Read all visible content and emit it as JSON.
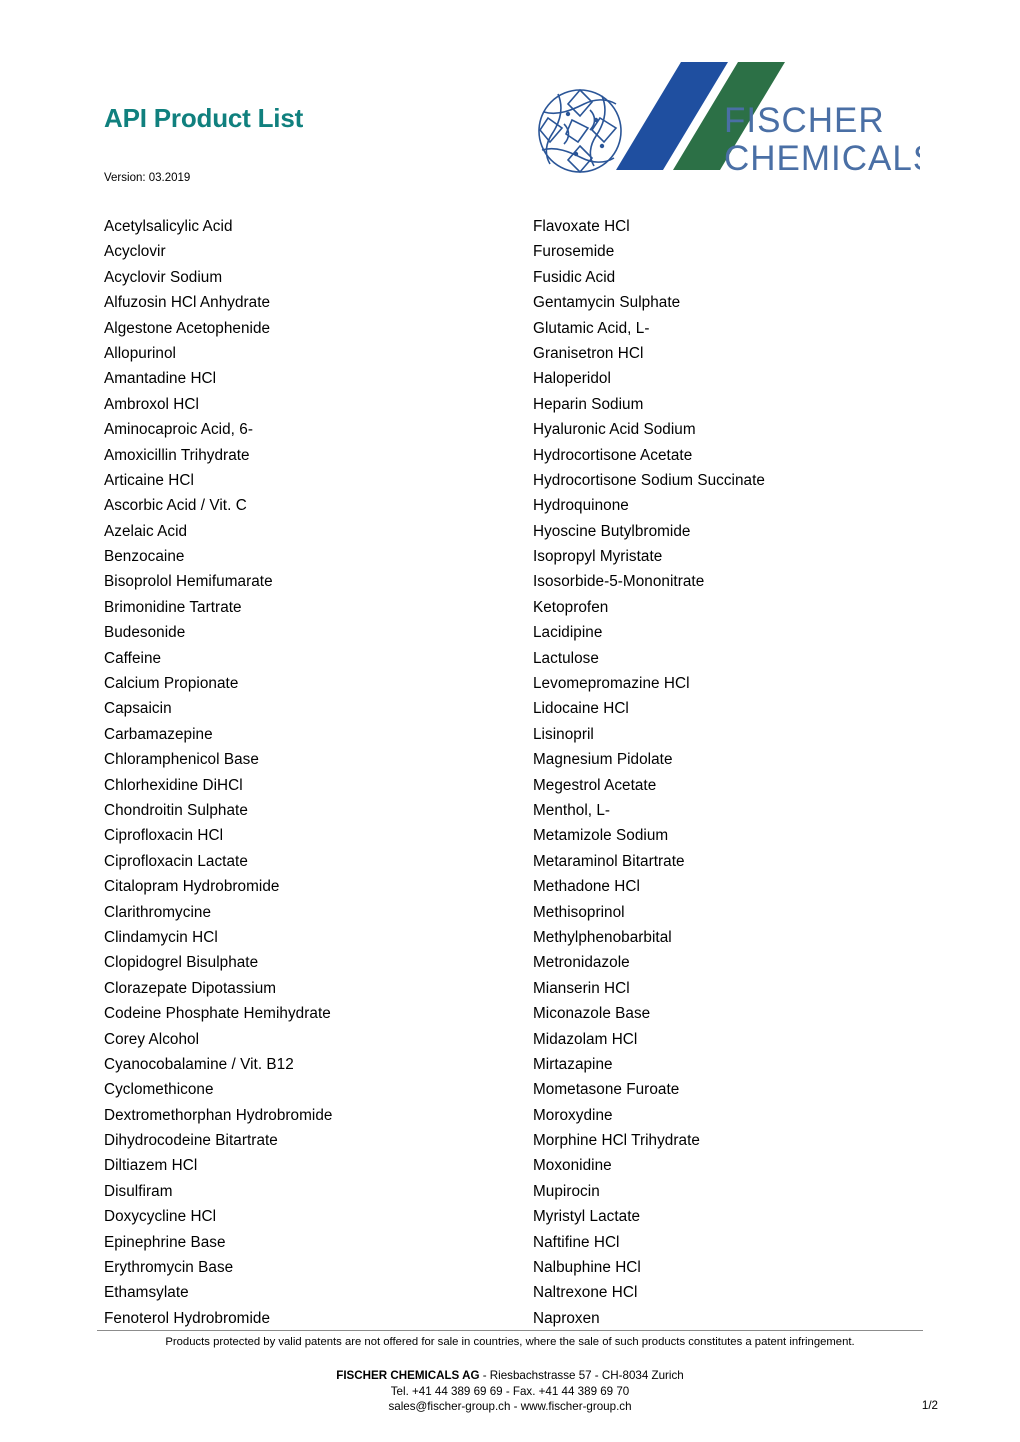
{
  "document": {
    "title": "API Product List",
    "version_label": "Version: 03.2019",
    "title_color": "#10807e"
  },
  "logo": {
    "emblem_name": "fischer-fish-circle-emblem",
    "line1": "FISCHER",
    "line2": "CHEMICALS AG",
    "stripe_blue": "#1f4fa0",
    "stripe_green": "#2c7046",
    "wordmark_color": "#4a6fa5",
    "emblem_color": "#2a5597"
  },
  "products": {
    "left_column": [
      "Acetylsalicylic Acid",
      "Acyclovir",
      "Acyclovir Sodium",
      "Alfuzosin HCl Anhydrate",
      "Algestone Acetophenide",
      "Allopurinol",
      "Amantadine HCl",
      "Ambroxol HCl",
      "Aminocaproic Acid, 6-",
      "Amoxicillin Trihydrate",
      "Articaine HCl",
      "Ascorbic Acid / Vit. C",
      "Azelaic Acid",
      "Benzocaine",
      "Bisoprolol Hemifumarate",
      "Brimonidine Tartrate",
      "Budesonide",
      "Caffeine",
      "Calcium Propionate",
      "Capsaicin",
      "Carbamazepine",
      "Chloramphenicol Base",
      "Chlorhexidine DiHCl",
      "Chondroitin Sulphate",
      "Ciprofloxacin HCl",
      "Ciprofloxacin Lactate",
      "Citalopram Hydrobromide",
      "Clarithromycine",
      "Clindamycin HCl",
      "Clopidogrel Bisulphate",
      "Clorazepate Dipotassium",
      "Codeine Phosphate Hemihydrate",
      "Corey Alcohol",
      "Cyanocobalamine / Vit. B12",
      "Cyclomethicone",
      "Dextromethorphan Hydrobromide",
      "Dihydrocodeine Bitartrate",
      "Diltiazem HCl",
      "Disulfiram",
      "Doxycycline HCl",
      "Epinephrine Base",
      "Erythromycin Base",
      "Ethamsylate",
      "Fenoterol Hydrobromide"
    ],
    "right_column": [
      "Flavoxate HCl",
      "Furosemide",
      "Fusidic Acid",
      "Gentamycin Sulphate",
      "Glutamic Acid, L-",
      "Granisetron HCl",
      "Haloperidol",
      "Heparin Sodium",
      "Hyaluronic Acid Sodium",
      "Hydrocortisone Acetate",
      "Hydrocortisone Sodium Succinate",
      "Hydroquinone",
      "Hyoscine Butylbromide",
      "Isopropyl Myristate",
      "Isosorbide-5-Mononitrate",
      "Ketoprofen",
      "Lacidipine",
      "Lactulose",
      "Levomepromazine HCl",
      "Lidocaine HCl",
      "Lisinopril",
      "Magnesium Pidolate",
      "Megestrol Acetate",
      "Menthol, L-",
      "Metamizole Sodium",
      "Metaraminol Bitartrate",
      "Methadone HCl",
      "Methisoprinol",
      "Methylphenobarbital",
      "Metronidazole",
      "Mianserin HCl",
      "Miconazole Base",
      "Midazolam HCl",
      "Mirtazapine",
      "Mometasone Furoate",
      "Moroxydine",
      "Morphine HCl Trihydrate",
      "Moxonidine",
      "Mupirocin",
      "Myristyl Lactate",
      "Naftifine HCl",
      "Nalbuphine HCl",
      "Naltrexone HCl",
      "Naproxen"
    ]
  },
  "footer": {
    "patent_note": "Products protected by valid patents are not offered for sale in countries, where the sale of such products constitutes a patent infringement.",
    "company_name": "FISCHER CHEMICALS AG",
    "address_suffix": " - Riesbachstrasse 57 - CH-8034 Zurich",
    "phone_line": "Tel.  +41 44 389 69 69 - Fax. +41 44 389 69 70",
    "contact_line": "sales@fischer-group.ch - www.fischer-group.ch",
    "page_number": "1/2"
  }
}
